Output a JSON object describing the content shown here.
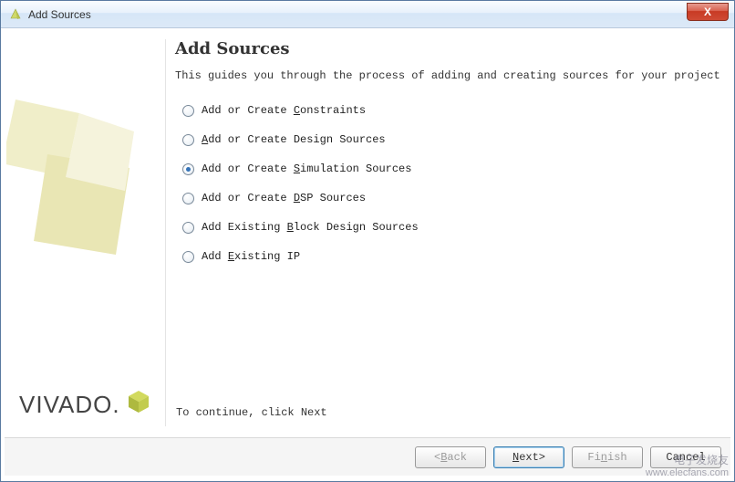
{
  "window": {
    "title": "Add Sources",
    "close_label": "X"
  },
  "main": {
    "heading": "Add Sources",
    "subtitle": "This guides you through the process of adding and creating sources for your project",
    "options": [
      {
        "pre": "Add or Create ",
        "u": "C",
        "post": "onstraints",
        "selected": false
      },
      {
        "pre": "",
        "u": "A",
        "post": "dd or Create Design Sources",
        "selected": false
      },
      {
        "pre": "Add or Create ",
        "u": "S",
        "post": "imulation Sources",
        "selected": true
      },
      {
        "pre": "Add or Create ",
        "u": "D",
        "post": "SP Sources",
        "selected": false
      },
      {
        "pre": "Add Existing ",
        "u": "B",
        "post": "lock Design Sources",
        "selected": false
      },
      {
        "pre": "Add ",
        "u": "E",
        "post": "xisting IP",
        "selected": false
      }
    ],
    "footer_note": "To continue, click Next"
  },
  "brand": {
    "logo_text": "VIVADO"
  },
  "buttons": {
    "back": {
      "lt": "< ",
      "u": "B",
      "post": "ack"
    },
    "next": {
      "u": "N",
      "post": "ext ",
      "gt": ">"
    },
    "finish": {
      "pre": "Fi",
      "u": "n",
      "post": "ish"
    },
    "cancel": {
      "label": "Cancel"
    }
  },
  "watermark": {
    "line1": "电子发烧友",
    "line2": "www.elecfans.com"
  }
}
